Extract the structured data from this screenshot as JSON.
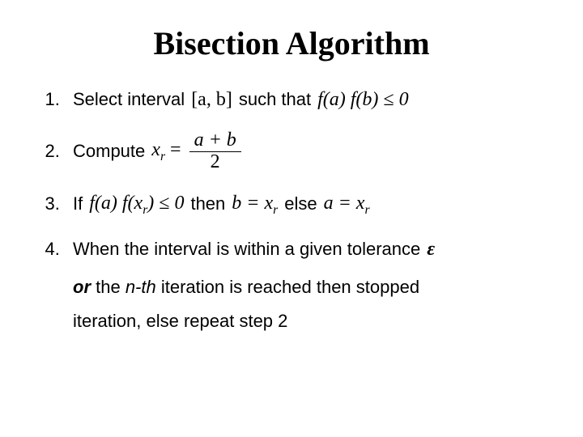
{
  "title": "Bisection Algorithm",
  "items": {
    "s1": {
      "lead": "Select interval",
      "interval": "[a, b]",
      "mid": "such that",
      "cond": "f(a) f(b) ≤ 0"
    },
    "s2": {
      "lead": "Compute",
      "lhs": "x",
      "lhs_sub": "r",
      "eq": " = ",
      "num": "a + b",
      "den": "2"
    },
    "s3": {
      "lead": "If",
      "cond": "f(a) f(x",
      "cond_sub": "r",
      "cond_tail": ") ≤ 0",
      "then_word": "then",
      "then_expr_lhs": "b = x",
      "then_expr_sub": "r",
      "else_word": "else",
      "else_expr_lhs": "a = x",
      "else_expr_sub": "r"
    },
    "s4": {
      "line1_a": "When the interval is within a given tolerance",
      "eps": "ε",
      "or_word": "or",
      "line2_rest": " the ",
      "nth": "n-th",
      "line2_tail": " iteration is reached then stopped",
      "line3": "iteration, else repeat step 2"
    }
  }
}
